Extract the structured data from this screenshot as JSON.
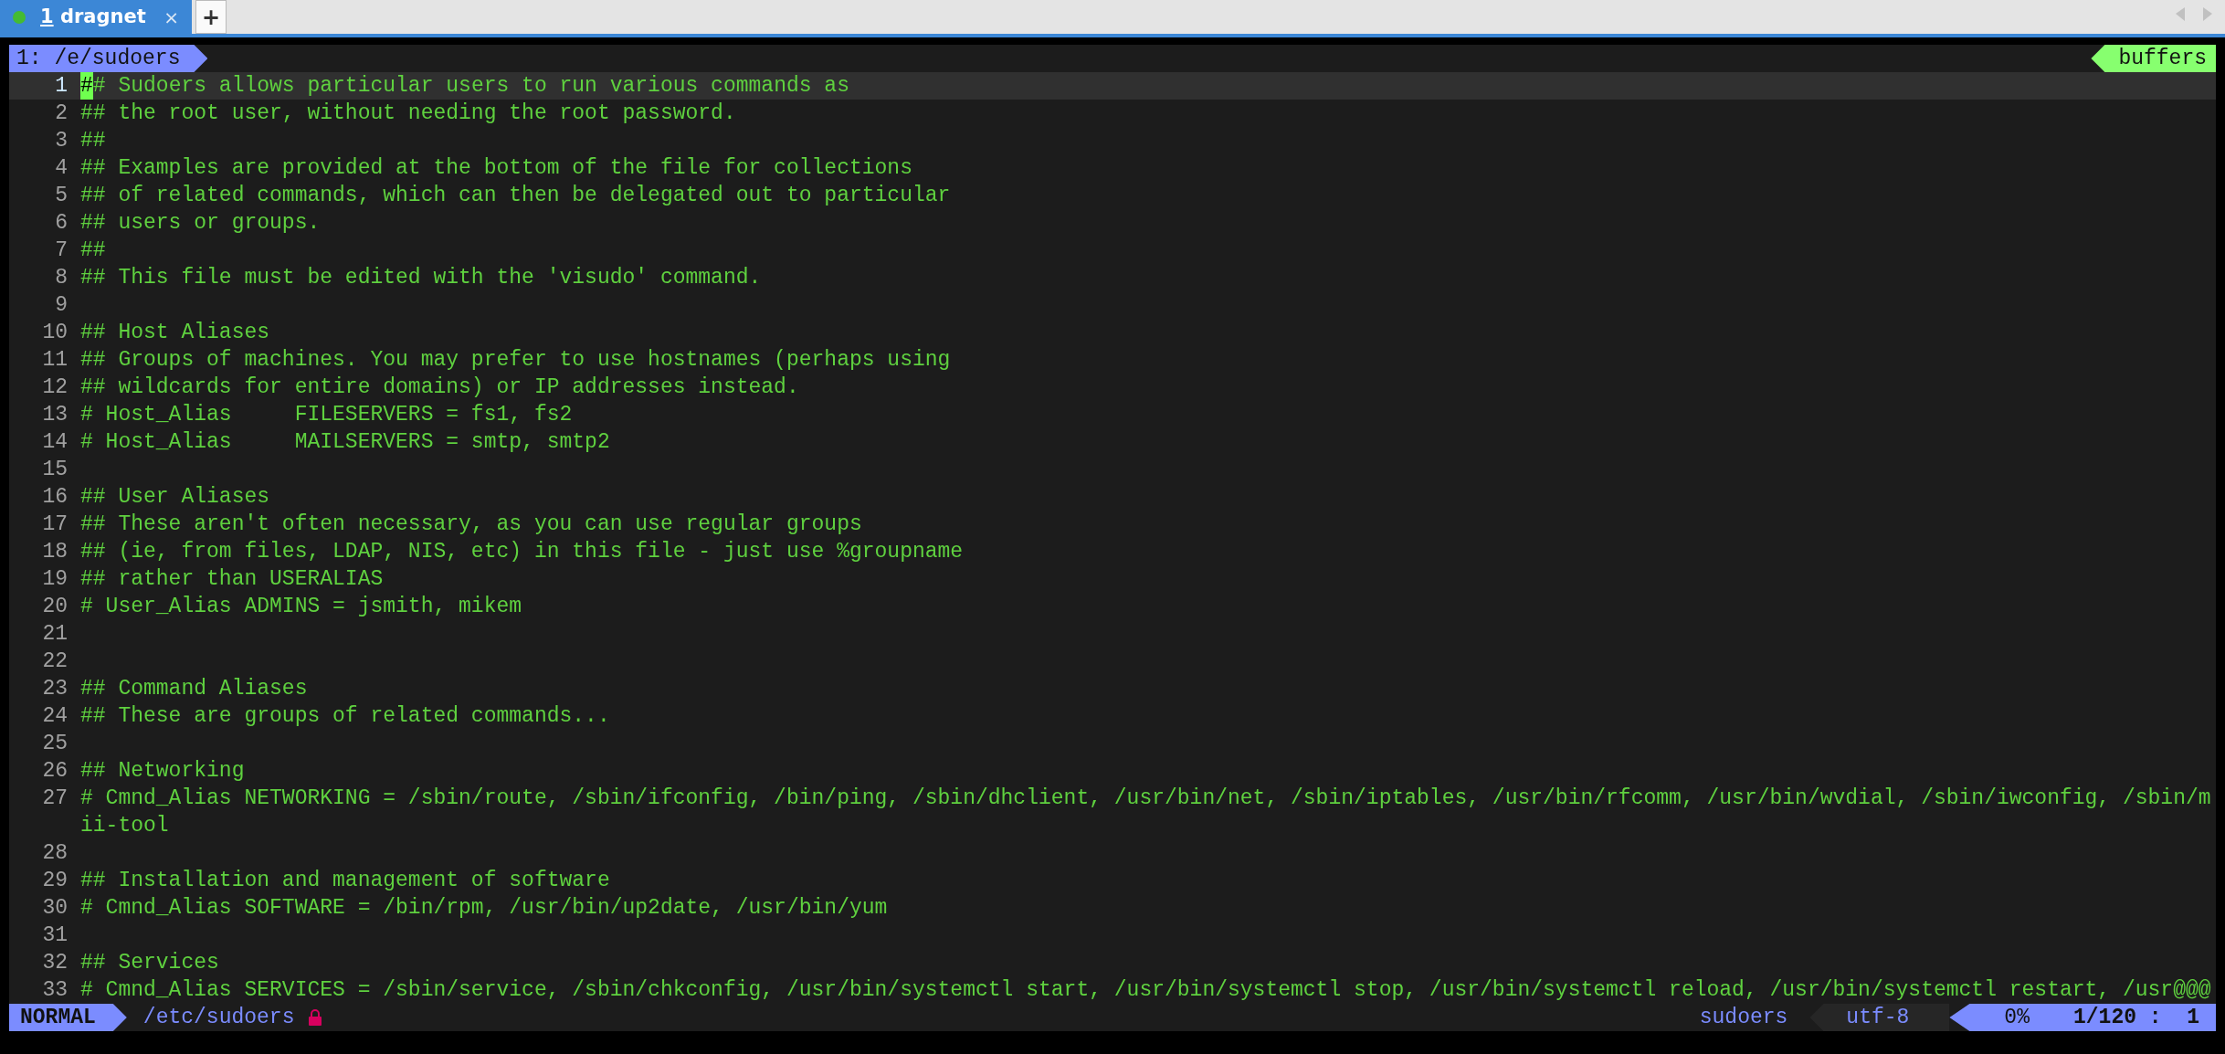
{
  "tabs": [
    {
      "number": "1",
      "title": "dragnet",
      "connected": true,
      "selected": true,
      "close": "×"
    }
  ],
  "new_tab": "+",
  "bufferline": {
    "buffer": "1: /e/sudoers",
    "right": "buffers"
  },
  "lines": [
    {
      "number": "1",
      "current": true,
      "cursor": "#",
      "text": "# Sudoers allows particular users to run various commands as"
    },
    {
      "number": "2",
      "current": false,
      "text": "## the root user, without needing the root password."
    },
    {
      "number": "3",
      "current": false,
      "text": "##"
    },
    {
      "number": "4",
      "current": false,
      "text": "## Examples are provided at the bottom of the file for collections"
    },
    {
      "number": "5",
      "current": false,
      "text": "## of related commands, which can then be delegated out to particular"
    },
    {
      "number": "6",
      "current": false,
      "text": "## users or groups."
    },
    {
      "number": "7",
      "current": false,
      "text": "##"
    },
    {
      "number": "8",
      "current": false,
      "text": "## This file must be edited with the 'visudo' command."
    },
    {
      "number": "9",
      "current": false
    },
    {
      "number": "10",
      "current": false,
      "text": "## Host Aliases"
    },
    {
      "number": "11",
      "current": false,
      "text": "## Groups of machines. You may prefer to use hostnames (perhaps using"
    },
    {
      "number": "12",
      "current": false,
      "text": "## wildcards for entire domains) or IP addresses instead."
    },
    {
      "number": "13",
      "current": false,
      "text": "# Host_Alias     FILESERVERS = fs1, fs2"
    },
    {
      "number": "14",
      "current": false,
      "text": "# Host_Alias     MAILSERVERS = smtp, smtp2"
    },
    {
      "number": "15",
      "current": false
    },
    {
      "number": "16",
      "current": false,
      "text": "## User Aliases"
    },
    {
      "number": "17",
      "current": false,
      "text": "## These aren't often necessary, as you can use regular groups"
    },
    {
      "number": "18",
      "current": false,
      "text": "## (ie, from files, LDAP, NIS, etc) in this file - just use %groupname"
    },
    {
      "number": "19",
      "current": false,
      "text": "## rather than USERALIAS"
    },
    {
      "number": "20",
      "current": false,
      "text": "# User_Alias ADMINS = jsmith, mikem"
    },
    {
      "number": "21",
      "current": false
    },
    {
      "number": "22",
      "current": false
    },
    {
      "number": "23",
      "current": false,
      "text": "## Command Aliases"
    },
    {
      "number": "24",
      "current": false,
      "text": "## These are groups of related commands..."
    },
    {
      "number": "25",
      "current": false
    },
    {
      "number": "26",
      "current": false,
      "text": "## Networking"
    },
    {
      "number": "27",
      "current": false,
      "text": "# Cmnd_Alias NETWORKING = /sbin/route, /sbin/ifconfig, /bin/ping, /sbin/dhclient, /usr/bin/net, /sbin/iptables, /usr/bin/rfcomm, /usr/bin/wvdial, /sbin/iwconfig, /sbin/m",
      "continuation": "ii-tool"
    },
    {
      "number": "28",
      "current": false
    },
    {
      "number": "29",
      "current": false,
      "text": "## Installation and management of software"
    },
    {
      "number": "30",
      "current": false,
      "text": "# Cmnd_Alias SOFTWARE = /bin/rpm, /usr/bin/up2date, /usr/bin/yum"
    },
    {
      "number": "31",
      "current": false
    },
    {
      "number": "32",
      "current": false,
      "text": "## Services"
    },
    {
      "number": "33",
      "current": false,
      "text": "# Cmnd_Alias SERVICES = /sbin/service, /sbin/chkconfig, /usr/bin/systemctl start, /usr/bin/systemctl stop, /usr/bin/systemctl reload, /usr/bin/systemctl restart, /usr@@@"
    }
  ],
  "status_bar": {
    "mode": "NORMAL",
    "file": "/etc/sudoers",
    "readonly": true,
    "filetype": "sudoers",
    "encoding": "utf-8",
    "percent": "0%",
    "position": "1/120 :  1"
  }
}
